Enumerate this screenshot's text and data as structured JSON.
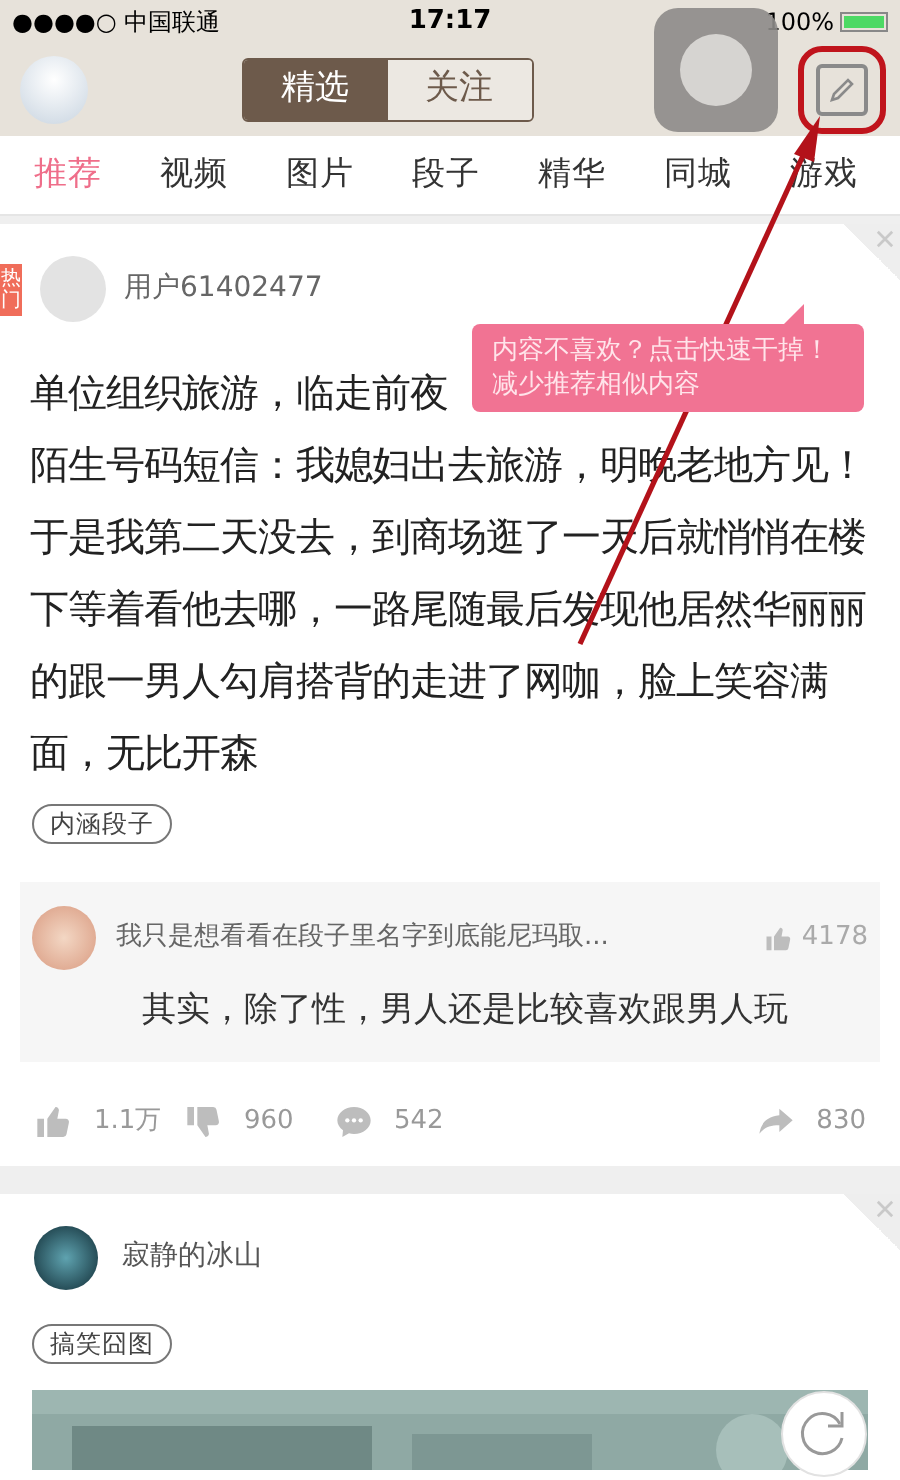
{
  "status_bar": {
    "carrier": "●●●●○ 中国联通",
    "time": "17:17",
    "battery": "100%"
  },
  "header_tabs": [
    {
      "label": "精选",
      "selected": true
    },
    {
      "label": "关注",
      "selected": false
    }
  ],
  "channels": [
    {
      "label": "推荐",
      "selected": true
    },
    {
      "label": "视频",
      "selected": false
    },
    {
      "label": "图片",
      "selected": false
    },
    {
      "label": "段子",
      "selected": false
    },
    {
      "label": "精华",
      "selected": false
    },
    {
      "label": "同城",
      "selected": false
    },
    {
      "label": "游戏",
      "selected": false
    }
  ],
  "posts": [
    {
      "kind": "text",
      "hot_badge": "热门",
      "user": "用户61402477",
      "text_start": "单位组织旅游，临走前夜",
      "text": "陌生号码短信：我媳妇出去旅游，明晚老地方见！于是我第二天没去，到商场逛了一天后就悄悄在楼下等着看他去哪，一路尾随最后发现他居然华丽丽的跟一男人勾肩搭背的走进了网咖，脸上笑容满面，无比开森",
      "tag": "内涵段子",
      "comment": {
        "user": "我只是想看看在段子里名字到底能尼玛取...",
        "likes": "4178",
        "text": "其实，除了性，男人还是比较喜欢跟男人玩"
      },
      "likes": "1.1万",
      "dislikes": "960",
      "comments": "542",
      "shares": "830"
    },
    {
      "kind": "picture",
      "user": "寂静的冰山",
      "tag": "搞笑囧图"
    }
  ],
  "tooltip": "内容不喜欢？点击快速干掉！减少推荐相似内容"
}
